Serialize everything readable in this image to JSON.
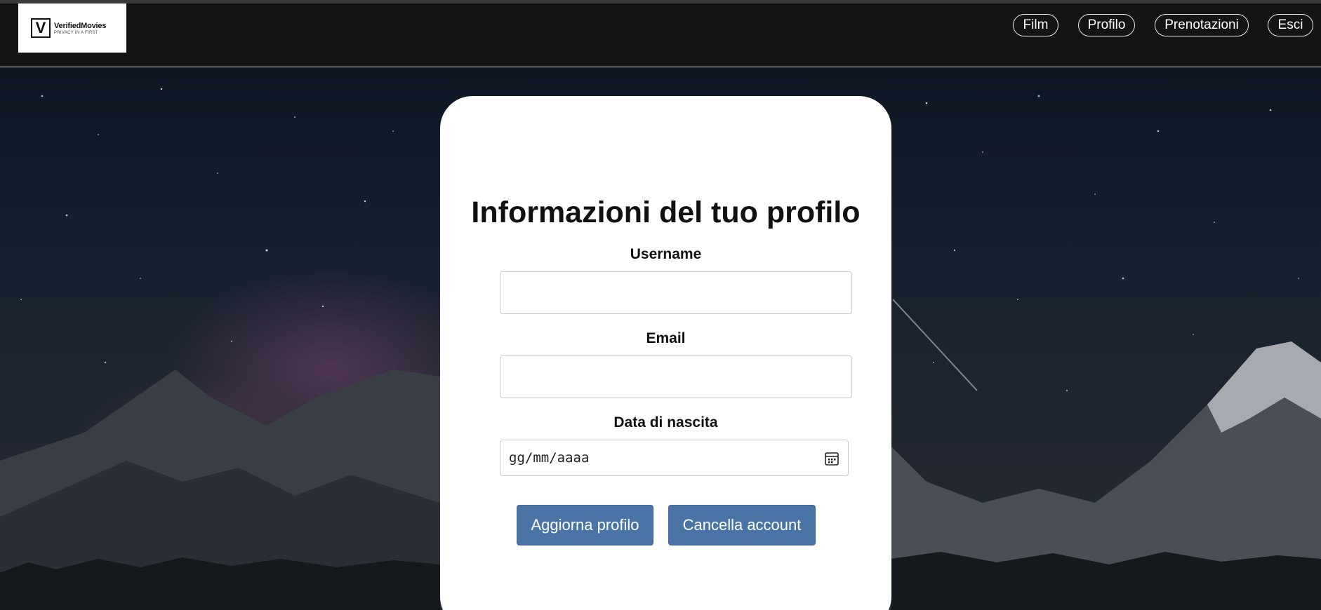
{
  "header": {
    "logo": {
      "mark": "V",
      "name": "VerifiedMovies",
      "tagline": "PRIVACY IN A FIRST"
    },
    "nav": [
      {
        "label": "Film"
      },
      {
        "label": "Profilo"
      },
      {
        "label": "Prenotazioni"
      },
      {
        "label": "Esci"
      }
    ]
  },
  "profile_card": {
    "title": "Informazioni del tuo profilo",
    "username": {
      "label": "Username",
      "value": ""
    },
    "email": {
      "label": "Email",
      "value": ""
    },
    "birthdate": {
      "label": "Data di nascita",
      "placeholder": "gg/mm/aaaa",
      "icon": "calendar-icon"
    },
    "buttons": {
      "update": "Aggiorna profilo",
      "delete": "Cancella account"
    }
  },
  "colors": {
    "navbar": "#141414",
    "button": "#4a74a6",
    "card": "#ffffff"
  }
}
